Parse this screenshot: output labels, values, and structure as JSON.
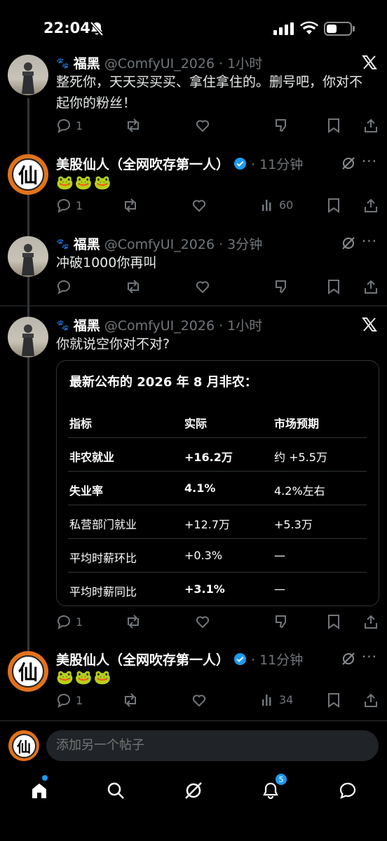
{
  "status_bar": {
    "time": "22:04"
  },
  "posts": [
    {
      "name": "福黑",
      "handle": "@ComfyUI_2026 · 1小时",
      "text": "整死你，天天买买买、拿住拿住的。删号吧，你对不起你的粉丝！",
      "replies": "1"
    },
    {
      "name": "美股仙人（全网吹存第一人）",
      "time": "· 11分钟",
      "text": "🐸🐸🐸",
      "replies": "1",
      "views": "60"
    },
    {
      "name": "福黑",
      "handle": "@ComfyUI_2026 · 3分钟",
      "text": "冲破1000你再叫"
    },
    {
      "name": "福黑",
      "handle": "@ComfyUI_2026 · 1小时",
      "text": "你就说空你对不对?",
      "replies": "1"
    },
    {
      "name": "美股仙人（全网吹存第一人）",
      "time": "· 11分钟",
      "text": "🐸🐸🐸",
      "replies": "1",
      "views": "34"
    }
  ],
  "card": {
    "title": "最新公布的 2026 年 8 月非农：",
    "headers": [
      "指标",
      "实际",
      "市场预期"
    ],
    "rows": [
      [
        "非农就业",
        "+16.2万",
        "约 +5.5万"
      ],
      [
        "失业率",
        "4.1%",
        "4.2%左右"
      ],
      [
        "私营部门就业",
        "+12.7万",
        "+5.3万"
      ],
      [
        "平均时薪环比",
        "+0.3%",
        "—"
      ],
      [
        "平均时薪同比",
        "+3.1%",
        "—"
      ]
    ]
  },
  "avatar_glyph": "仙",
  "reply_bar": {
    "placeholder": "添加另一个帖子"
  },
  "nav": {
    "notifications_badge": "5"
  },
  "icons": {
    "paw": "🐾",
    "more": "···"
  },
  "colors": {
    "accent": "#1d9bf0",
    "avatar_orange": "#e1721c"
  }
}
